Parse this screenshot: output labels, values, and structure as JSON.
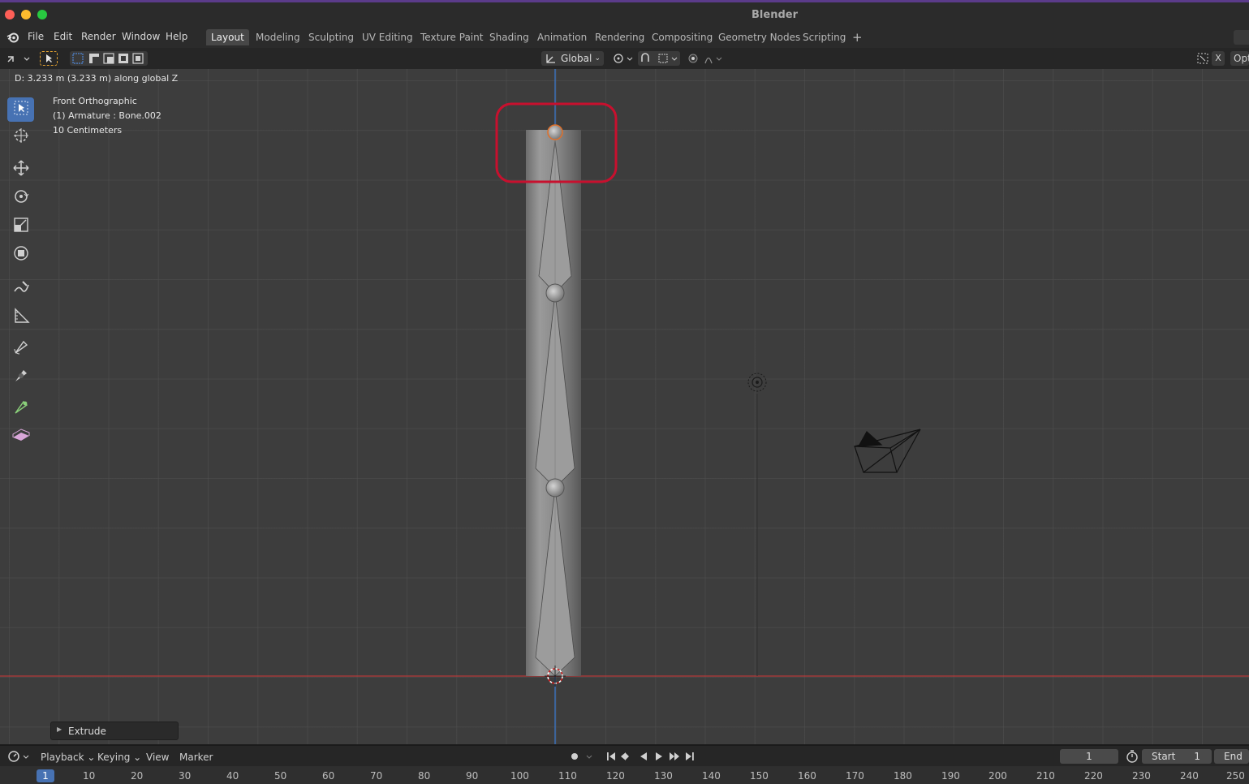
{
  "window": {
    "title": "Blender"
  },
  "menu": {
    "items": [
      "File",
      "Edit",
      "Render",
      "Window",
      "Help"
    ]
  },
  "workspaces": {
    "active": "Layout",
    "tabs": [
      "Layout",
      "Modeling",
      "Sculpting",
      "UV Editing",
      "Texture Paint",
      "Shading",
      "Animation",
      "Rendering",
      "Compositing",
      "Geometry Nodes",
      "Scripting"
    ],
    "add": "+"
  },
  "header": {
    "orientation": "Global",
    "options_label": "Opt",
    "close_x": "X"
  },
  "viewport": {
    "status": "D: 3.233 m (3.233 m) along global Z",
    "view_name": "Front Orthographic",
    "object": "(1) Armature : Bone.002",
    "scale": "10 Centimeters",
    "operator_panel": "Extrude"
  },
  "timeline": {
    "menus": [
      "Playback",
      "Keying",
      "View",
      "Marker"
    ],
    "current_frame": "1",
    "start_label": "Start",
    "start_value": "1",
    "end_label": "End",
    "ruler": [
      "1",
      "10",
      "20",
      "30",
      "40",
      "50",
      "60",
      "70",
      "80",
      "90",
      "100",
      "110",
      "120",
      "130",
      "140",
      "150",
      "160",
      "170",
      "180",
      "190",
      "200",
      "210",
      "220",
      "230",
      "240",
      "250"
    ]
  },
  "colors": {
    "accent": "#4772b3",
    "highlight_box": "#c8102e",
    "x_axis": "#b63a3a",
    "z_axis": "#3a7bd5"
  }
}
